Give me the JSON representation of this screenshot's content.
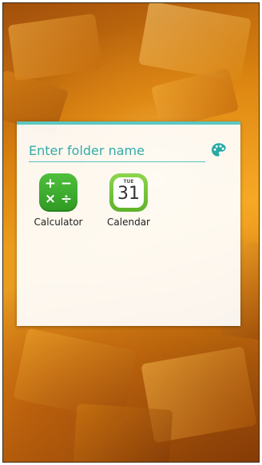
{
  "wallpaper": {
    "theme": "orange abstract 3D blocks"
  },
  "folder": {
    "name_placeholder": "Enter folder name",
    "name_value": "",
    "accent_color": "#5cc7c2",
    "palette_icon": "palette-icon",
    "apps": [
      {
        "label": "Calculator",
        "icon": "calculator-icon",
        "symbols": [
          "+",
          "−",
          "×",
          "÷"
        ],
        "color": "#3aa82c"
      },
      {
        "label": "Calendar",
        "icon": "calendar-icon",
        "day": "TUE",
        "date": "31",
        "color": "#6cbf36"
      }
    ]
  }
}
